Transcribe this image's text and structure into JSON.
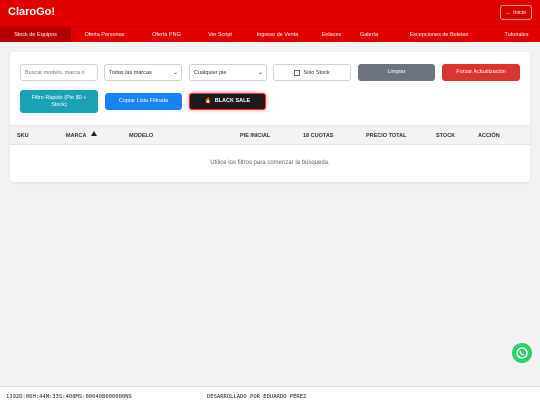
{
  "header": {
    "logo": "ClaroGo!",
    "home_label": "Inicio"
  },
  "nav": {
    "tabs": [
      {
        "label": "Stock de Equipos",
        "active": true
      },
      {
        "label": "Oferta Personas",
        "active": false
      },
      {
        "label": "Oferta PNG",
        "active": false
      },
      {
        "label": "Ver Script",
        "active": false
      },
      {
        "label": "Ingreso de Venta",
        "active": false
      },
      {
        "label": "Enlaces",
        "active": false
      },
      {
        "label": "Galería",
        "active": false
      },
      {
        "label": "Excepciones de Boletas",
        "active": false
      },
      {
        "label": "Tutoriales",
        "active": false
      }
    ]
  },
  "filters": {
    "search_placeholder": "Buscar modelo, marca o",
    "brand_select": "Todas las marcas",
    "pie_select": "Cualquier pie",
    "solo_stock": "Solo Stock",
    "limpiar": "Limpiar",
    "forzar": "Forzar Actualización",
    "filtro_rapido": "Filtro Rápido (Pie $0 + Stock)",
    "copiar": "Copiar Lista Filtrada",
    "black_sale": "BLACK SALE"
  },
  "table": {
    "columns": [
      "SKU",
      "MARCA",
      "MODELO",
      "PIE INICIAL",
      "18 CUOTAS",
      "PRECIO TOTAL",
      "STOCK",
      "ACCIÓN"
    ],
    "empty_message": "Utilice los filtros para comenzar la búsqueda."
  },
  "footer": {
    "uptime": "1392D:06H:44M:33S:408MS:000408000000NS",
    "credit": "DESARROLLADO POR EDUARDO PÉREZ"
  },
  "colors": {
    "brand_red": "#e00000",
    "whatsapp": "#25d366"
  }
}
